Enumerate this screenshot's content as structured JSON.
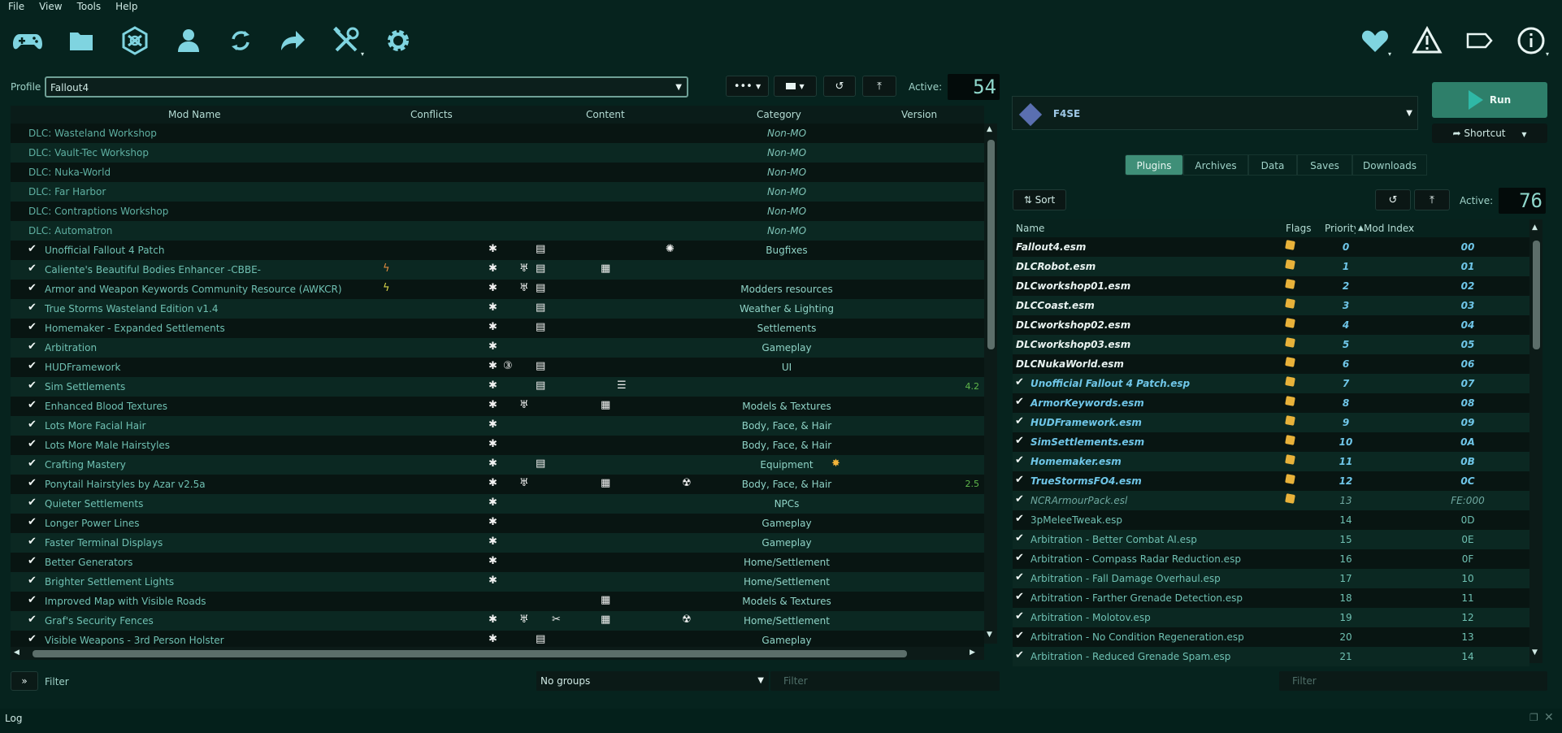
{
  "menu": [
    "File",
    "View",
    "Tools",
    "Help"
  ],
  "toolbar": {
    "left_icons": [
      "gamepad-icon",
      "folder-icon",
      "nexus-icon",
      "user-icon",
      "refresh-icon",
      "redo-arrow-icon",
      "tools-icon",
      "gear-icon"
    ],
    "right_icons": [
      "heart-icon",
      "warning-icon",
      "tag-icon",
      "info-icon"
    ]
  },
  "profile": {
    "label": "Profile",
    "value": "Fallout4",
    "active_label": "Active:",
    "active_count": "54"
  },
  "mod_table": {
    "headers": [
      "Mod Name",
      "Conflicts",
      "Content",
      "Category",
      "Version"
    ],
    "rows": [
      {
        "name": "DLC: Wasteland Workshop",
        "checked": false,
        "category": "Non-MO",
        "category_italic": true
      },
      {
        "name": "DLC: Vault-Tec Workshop",
        "checked": false,
        "category": "Non-MO",
        "category_italic": true
      },
      {
        "name": "DLC: Nuka-World",
        "checked": false,
        "category": "Non-MO",
        "category_italic": true
      },
      {
        "name": "DLC: Far Harbor",
        "checked": false,
        "category": "Non-MO",
        "category_italic": true
      },
      {
        "name": "DLC: Contraptions Workshop",
        "checked": false,
        "category": "Non-MO",
        "category_italic": true
      },
      {
        "name": "DLC: Automatron",
        "checked": false,
        "category": "Non-MO",
        "category_italic": true
      },
      {
        "name": "Unofficial Fallout 4 Patch",
        "checked": true,
        "category": "Bugfixes"
      },
      {
        "name": "Caliente's Beautiful Bodies Enhancer -CBBE-",
        "checked": true,
        "category": ""
      },
      {
        "name": "Armor and Weapon Keywords Community Resource (AWKCR)",
        "checked": true,
        "category": "Modders resources"
      },
      {
        "name": "True Storms Wasteland Edition v1.4",
        "checked": true,
        "category": "Weather & Lighting"
      },
      {
        "name": "Homemaker - Expanded Settlements",
        "checked": true,
        "category": "Settlements"
      },
      {
        "name": "Arbitration",
        "checked": true,
        "category": "Gameplay"
      },
      {
        "name": "HUDFramework",
        "checked": true,
        "category": "UI"
      },
      {
        "name": "Sim Settlements",
        "checked": true,
        "category": "",
        "version": "4.2"
      },
      {
        "name": "Enhanced Blood Textures",
        "checked": true,
        "category": "Models & Textures"
      },
      {
        "name": "Lots More Facial Hair",
        "checked": true,
        "category": "Body, Face, & Hair"
      },
      {
        "name": "Lots More Male Hairstyles",
        "checked": true,
        "category": "Body, Face, & Hair"
      },
      {
        "name": "Crafting Mastery",
        "checked": true,
        "category": "Equipment"
      },
      {
        "name": "Ponytail Hairstyles by Azar v2.5a",
        "checked": true,
        "category": "Body, Face, & Hair",
        "version": "2.5"
      },
      {
        "name": "Quieter Settlements",
        "checked": true,
        "category": "NPCs"
      },
      {
        "name": "Longer Power Lines",
        "checked": true,
        "category": "Gameplay"
      },
      {
        "name": "Faster Terminal Displays",
        "checked": true,
        "category": "Gameplay"
      },
      {
        "name": "Better Generators",
        "checked": true,
        "category": "Home/Settlement"
      },
      {
        "name": "Brighter Settlement Lights",
        "checked": true,
        "category": "Home/Settlement"
      },
      {
        "name": "Improved Map with Visible Roads",
        "checked": true,
        "category": "Models & Textures"
      },
      {
        "name": "Graf's Security Fences",
        "checked": true,
        "category": "Home/Settlement"
      },
      {
        "name": "Visible Weapons - 3rd Person Holster",
        "checked": true,
        "category": "Gameplay"
      }
    ]
  },
  "executable": {
    "name": "F4SE",
    "run_label": "Run",
    "shortcut_label": "Shortcut"
  },
  "tabs": [
    "Plugins",
    "Archives",
    "Data",
    "Saves",
    "Downloads"
  ],
  "plugins": {
    "sort_label": "Sort",
    "active_label": "Active:",
    "active_count": "76",
    "headers": [
      "Name",
      "Flags",
      "Priority",
      "Mod Index"
    ],
    "rows": [
      {
        "name": "Fallout4.esm",
        "checked": false,
        "style": "master",
        "priority": "0",
        "index": "00",
        "flag": true
      },
      {
        "name": "DLCRobot.esm",
        "checked": false,
        "style": "master",
        "priority": "1",
        "index": "01",
        "flag": true
      },
      {
        "name": "DLCworkshop01.esm",
        "checked": false,
        "style": "master",
        "priority": "2",
        "index": "02",
        "flag": true
      },
      {
        "name": "DLCCoast.esm",
        "checked": false,
        "style": "master",
        "priority": "3",
        "index": "03",
        "flag": true
      },
      {
        "name": "DLCworkshop02.esm",
        "checked": false,
        "style": "master",
        "priority": "4",
        "index": "04",
        "flag": true
      },
      {
        "name": "DLCworkshop03.esm",
        "checked": false,
        "style": "master",
        "priority": "5",
        "index": "05",
        "flag": true
      },
      {
        "name": "DLCNukaWorld.esm",
        "checked": false,
        "style": "master",
        "priority": "6",
        "index": "06",
        "flag": true
      },
      {
        "name": "Unofficial Fallout 4 Patch.esp",
        "checked": true,
        "style": "mastera",
        "priority": "7",
        "index": "07",
        "flag": true
      },
      {
        "name": "ArmorKeywords.esm",
        "checked": true,
        "style": "mastera",
        "priority": "8",
        "index": "08",
        "flag": true
      },
      {
        "name": "HUDFramework.esm",
        "checked": true,
        "style": "mastera",
        "priority": "9",
        "index": "09",
        "flag": true
      },
      {
        "name": "SimSettlements.esm",
        "checked": true,
        "style": "mastera",
        "priority": "10",
        "index": "0A",
        "flag": true
      },
      {
        "name": "Homemaker.esm",
        "checked": true,
        "style": "mastera",
        "priority": "11",
        "index": "0B",
        "flag": true
      },
      {
        "name": "TrueStormsFO4.esm",
        "checked": true,
        "style": "mastera",
        "priority": "12",
        "index": "0C",
        "flag": true
      },
      {
        "name": "NCRArmourPack.esl",
        "checked": true,
        "style": "light",
        "priority": "13",
        "index": "FE:000",
        "flag": true
      },
      {
        "name": "3pMeleeTweak.esp",
        "checked": true,
        "style": "plain",
        "priority": "14",
        "index": "0D"
      },
      {
        "name": "Arbitration - Better Combat AI.esp",
        "checked": true,
        "style": "plain",
        "priority": "15",
        "index": "0E"
      },
      {
        "name": "Arbitration - Compass Radar Reduction.esp",
        "checked": true,
        "style": "plain",
        "priority": "16",
        "index": "0F"
      },
      {
        "name": "Arbitration - Fall Damage Overhaul.esp",
        "checked": true,
        "style": "plain",
        "priority": "17",
        "index": "10"
      },
      {
        "name": "Arbitration - Farther Grenade Detection.esp",
        "checked": true,
        "style": "plain",
        "priority": "18",
        "index": "11"
      },
      {
        "name": "Arbitration - Molotov.esp",
        "checked": true,
        "style": "plain",
        "priority": "19",
        "index": "12"
      },
      {
        "name": "Arbitration - No Condition Regeneration.esp",
        "checked": true,
        "style": "plain",
        "priority": "20",
        "index": "13"
      },
      {
        "name": "Arbitration - Reduced Grenade Spam.esp",
        "checked": true,
        "style": "plain",
        "priority": "21",
        "index": "14"
      }
    ]
  },
  "bottom": {
    "filter_toggle": "»",
    "filter_label": "Filter",
    "groups_value": "No groups",
    "mod_filter_placeholder": "Filter",
    "plugin_filter_placeholder": "Filter",
    "log_label": "Log"
  },
  "colors": {
    "background": "#06231e",
    "accent_teal": "#3f8f78",
    "text_teal": "#6fc0b2",
    "master_blue": "#6fc6e8"
  }
}
